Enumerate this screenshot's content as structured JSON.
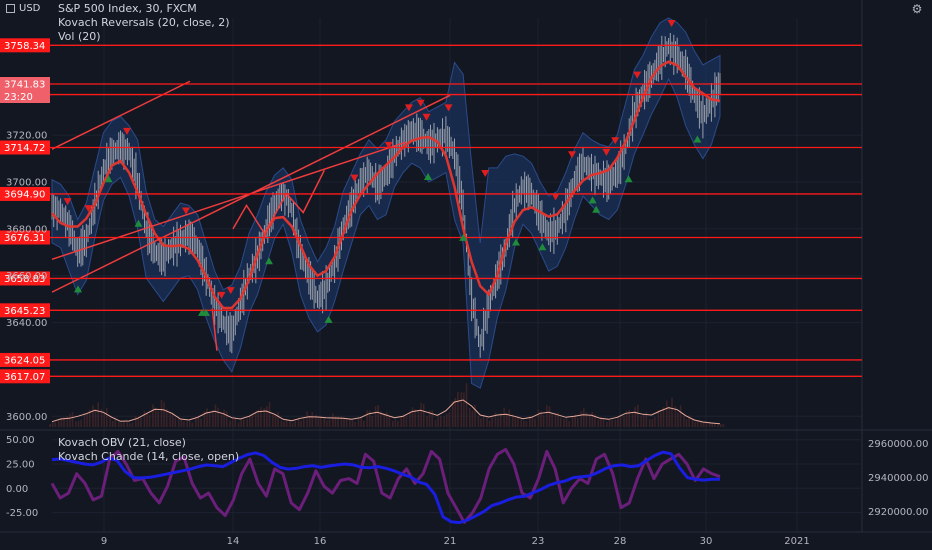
{
  "header": {
    "currency_label": "USD",
    "symbol_line": "S&P 500 Index, 30, FXCM",
    "indicator_1": "Kovach Reversals (20, close, 2)",
    "indicator_2": "Vol (20)",
    "lower_indicator_1": "Kovach OBV (21, close)",
    "lower_indicator_2": "Kovach Chande (14, close, open)"
  },
  "colors": {
    "background": "#131722",
    "grid": "#1e2230",
    "level_line": "#ff1a1a",
    "price_tag": "#ff1a1a",
    "trend_line": "#f03c3c",
    "band": "#1e3a6e",
    "candle": "#9aa0ab",
    "center_line": "#e0352f",
    "up_arrow": "#1e8c3a",
    "down_arrow": "#e01e1e",
    "volume": "#3a2226",
    "volume_ma": "#e8a898",
    "obv": "#1a1ee0",
    "chande": "#6b1f7a"
  },
  "chart_data": [
    {
      "type": "candlestick",
      "title": "S&P 500 Index, 30, FXCM",
      "y_axis_ticks": [
        "3720.00",
        "3700.00",
        "3680.00",
        "3660.00",
        "3640.00",
        "3600.00"
      ],
      "ylim": [
        3595,
        3770
      ],
      "x_tick_labels": [
        "9",
        "14",
        "16",
        "21",
        "23",
        "28",
        "30",
        "2021"
      ],
      "horizontal_levels": [
        "3758.34",
        "3741.83",
        "3737.32",
        "3714.72",
        "3694.90",
        "3676.31",
        "3658.83",
        "3645.23",
        "3624.05",
        "3617.07"
      ],
      "current_price_tag": {
        "price": "3741.83",
        "countdown": "23:20"
      },
      "trend_lines": [
        {
          "from": {
            "day": "8",
            "price": 3714
          },
          "to": {
            "day": "12",
            "price": 3743
          }
        },
        {
          "from": {
            "day": "8",
            "price": 3667
          },
          "to": {
            "day": "18",
            "price": 3717
          }
        },
        {
          "from": {
            "day": "8",
            "price": 3653
          },
          "to": {
            "day": "21",
            "price": 3737
          }
        }
      ],
      "path_close": [
        3690,
        3688,
        3682,
        3670,
        3675,
        3690,
        3705,
        3712,
        3715,
        3713,
        3700,
        3680,
        3670,
        3668,
        3672,
        3675,
        3678,
        3672,
        3660,
        3648,
        3640,
        3635,
        3648,
        3660,
        3668,
        3680,
        3690,
        3697,
        3688,
        3670,
        3660,
        3650,
        3655,
        3665,
        3680,
        3690,
        3700,
        3705,
        3698,
        3703,
        3712,
        3718,
        3722,
        3720,
        3716,
        3718,
        3720,
        3712,
        3690,
        3650,
        3630,
        3648,
        3660,
        3672,
        3690,
        3698,
        3695,
        3685,
        3678,
        3680,
        3688,
        3700,
        3708,
        3705,
        3702,
        3700,
        3704,
        3715,
        3730,
        3738,
        3745,
        3752,
        3758,
        3754,
        3748,
        3737,
        3728,
        3734,
        3742
      ],
      "path_high": [
        3695,
        3693,
        3688,
        3678,
        3685,
        3700,
        3715,
        3720,
        3722,
        3718,
        3712,
        3690,
        3678,
        3675,
        3680,
        3685,
        3684,
        3680,
        3668,
        3656,
        3648,
        3650,
        3658,
        3672,
        3680,
        3690,
        3697,
        3700,
        3695,
        3678,
        3668,
        3660,
        3666,
        3675,
        3690,
        3698,
        3706,
        3712,
        3708,
        3712,
        3720,
        3724,
        3728,
        3730,
        3724,
        3726,
        3728,
        3745,
        3740,
        3702,
        3668,
        3700,
        3700,
        3705,
        3706,
        3705,
        3702,
        3694,
        3688,
        3690,
        3698,
        3708,
        3715,
        3712,
        3710,
        3709,
        3714,
        3728,
        3742,
        3748,
        3756,
        3762,
        3764,
        3762,
        3758,
        3750,
        3744,
        3746,
        3748
      ],
      "path_low": [
        3680,
        3678,
        3668,
        3658,
        3664,
        3682,
        3698,
        3705,
        3708,
        3700,
        3686,
        3665,
        3660,
        3655,
        3660,
        3665,
        3666,
        3660,
        3648,
        3638,
        3630,
        3625,
        3635,
        3650,
        3658,
        3670,
        3682,
        3688,
        3676,
        3658,
        3648,
        3642,
        3645,
        3655,
        3668,
        3680,
        3692,
        3696,
        3690,
        3692,
        3704,
        3710,
        3714,
        3712,
        3706,
        3708,
        3710,
        3690,
        3680,
        3620,
        3618,
        3630,
        3648,
        3660,
        3678,
        3688,
        3684,
        3676,
        3668,
        3670,
        3678,
        3690,
        3700,
        3696,
        3692,
        3690,
        3694,
        3705,
        3718,
        3726,
        3735,
        3742,
        3750,
        3742,
        3730,
        3722,
        3716,
        3722,
        3734
      ],
      "buy_signals_day": [
        "8.5",
        "9.2",
        "10.5",
        "12.6",
        "12.8",
        "14.8",
        "16.2",
        "19.5",
        "21.3",
        "22.5",
        "23.2",
        "25.7",
        "25.9",
        "28.2",
        "29.8"
      ],
      "sell_signals_day": [
        "8.3",
        "8.7",
        "10.0",
        "11.9",
        "13.5",
        "13.9",
        "16.8",
        "17.6",
        "18.2",
        "19.0",
        "19.4",
        "20.9",
        "21.8",
        "23.8",
        "24.6",
        "26.6",
        "27.4",
        "28.4",
        "29.2"
      ]
    },
    {
      "type": "bar",
      "title": "Vol (20)",
      "values": [
        4,
        8,
        12,
        6,
        14,
        20,
        16,
        8,
        5,
        4,
        9,
        13,
        18,
        22,
        12,
        7,
        5,
        9,
        15,
        18,
        14,
        8,
        6,
        10,
        16,
        20,
        12,
        6,
        5,
        8,
        13,
        10,
        7,
        11,
        9,
        6,
        8,
        14,
        18,
        12,
        6,
        10,
        16,
        20,
        14,
        9,
        12,
        28,
        35,
        18,
        10,
        8,
        12,
        16,
        10,
        6,
        9,
        14,
        18,
        12,
        7,
        10,
        15,
        12,
        8,
        6,
        9,
        14,
        18,
        12,
        8,
        16,
        24,
        18,
        10,
        6,
        5,
        4,
        3
      ]
    },
    {
      "type": "line",
      "title": "Kovach OBV (21, close) / Kovach Chande (14, close, open)",
      "left_axis_ticks": [
        "50.00",
        "25.00",
        "0.00",
        "-25.00"
      ],
      "left_ylim": [
        -45,
        60
      ],
      "right_axis_ticks": [
        "2960000.00",
        "2940000.00",
        "2920000.00"
      ],
      "right_ylim": [
        2908000,
        2968000
      ],
      "series": [
        {
          "name": "Kovach OBV (21, close)",
          "axis": "right",
          "values": [
            2950500,
            2951000,
            2950000,
            2949000,
            2948000,
            2947500,
            2949000,
            2951500,
            2950000,
            2943500,
            2940000,
            2939800,
            2940200,
            2941000,
            2942000,
            2943000,
            2944000,
            2945000,
            2946500,
            2947500,
            2947000,
            2946500,
            2949000,
            2951500,
            2953500,
            2954500,
            2953000,
            2949000,
            2946000,
            2945000,
            2945500,
            2946500,
            2947000,
            2946000,
            2946800,
            2947500,
            2948000,
            2947500,
            2946000,
            2945800,
            2946500,
            2945500,
            2944000,
            2942000,
            2940500,
            2937500,
            2936000,
            2930000,
            2917000,
            2914000,
            2913500,
            2915000,
            2917500,
            2920000,
            2923500,
            2925000,
            2927000,
            2928500,
            2929000,
            2931000,
            2933000,
            2935500,
            2937000,
            2938000,
            2940000,
            2940500,
            2941000,
            2943000,
            2945500,
            2947000,
            2947500,
            2946500,
            2947000,
            2950000,
            2953000,
            2955000,
            2954000,
            2946000,
            2940000,
            2939000,
            2938500,
            2939000,
            2939000
          ]
        },
        {
          "name": "Kovach Chande (14, close, open)",
          "axis": "left",
          "values": [
            5,
            -10,
            -5,
            15,
            5,
            -12,
            -8,
            30,
            38,
            25,
            8,
            10,
            -5,
            -15,
            2,
            28,
            32,
            5,
            -10,
            -5,
            -20,
            -28,
            -12,
            15,
            30,
            5,
            -8,
            20,
            15,
            -15,
            -22,
            -5,
            18,
            2,
            -5,
            8,
            10,
            5,
            35,
            28,
            -5,
            -10,
            10,
            20,
            5,
            15,
            38,
            30,
            -5,
            -20,
            -35,
            -25,
            -10,
            20,
            35,
            40,
            25,
            -5,
            -10,
            10,
            38,
            20,
            -15,
            0,
            10,
            5,
            30,
            35,
            15,
            -20,
            -15,
            10,
            30,
            10,
            25,
            30,
            35,
            25,
            8,
            20,
            15,
            12
          ]
        }
      ]
    }
  ]
}
